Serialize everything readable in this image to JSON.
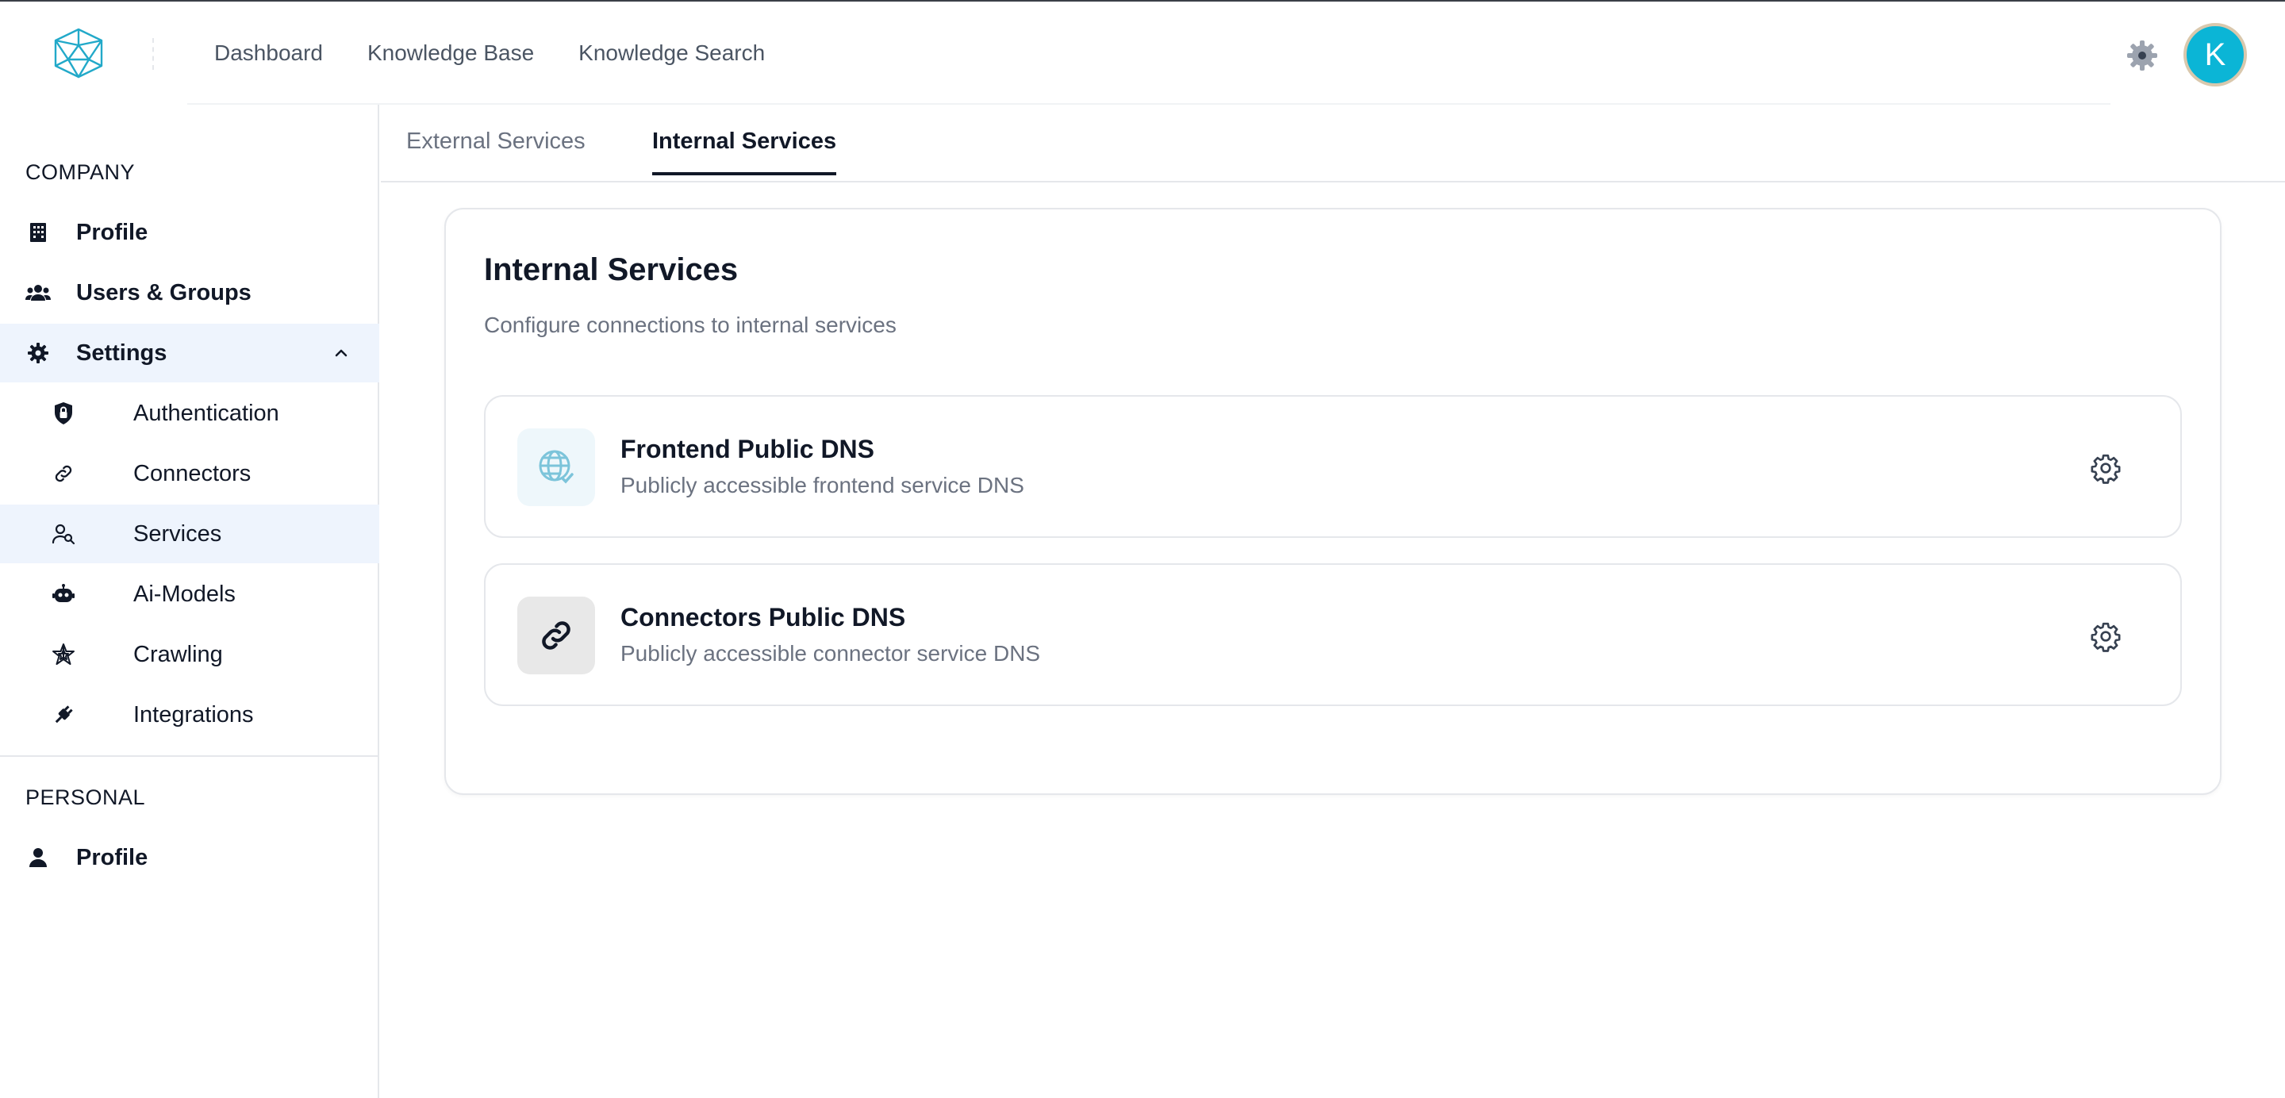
{
  "header": {
    "logo_icon": "polyhedron-logo-icon",
    "nav": [
      "Dashboard",
      "Knowledge Base",
      "Knowledge Search"
    ],
    "settings_icon": "gear-icon",
    "avatar_initial": "K",
    "accent_color": "#0bb5d6"
  },
  "sidebar": {
    "company_label": "COMPANY",
    "personal_label": "PERSONAL",
    "items": [
      {
        "label": "Profile",
        "icon": "building-icon"
      },
      {
        "label": "Users & Groups",
        "icon": "users-icon"
      },
      {
        "label": "Settings",
        "icon": "gear-icon",
        "expanded": true
      },
      {
        "label": "Authentication",
        "icon": "shield-lock-icon"
      },
      {
        "label": "Connectors",
        "icon": "link-icon"
      },
      {
        "label": "Services",
        "icon": "user-search-icon",
        "active": true
      },
      {
        "label": "Ai-Models",
        "icon": "robot-icon"
      },
      {
        "label": "Crawling",
        "icon": "spider-web-icon"
      },
      {
        "label": "Integrations",
        "icon": "plug-icon"
      }
    ],
    "personal_items": [
      {
        "label": "Profile",
        "icon": "person-icon"
      }
    ]
  },
  "tabs": [
    {
      "label": "External Services",
      "active": false
    },
    {
      "label": "Internal Services",
      "active": true
    }
  ],
  "main": {
    "title": "Internal Services",
    "subtitle": "Configure connections to internal services",
    "services": [
      {
        "name": "Frontend Public DNS",
        "description": "Publicly accessible frontend service DNS",
        "icon": "globe-check-icon",
        "icon_bg": "#eef7fb"
      },
      {
        "name": "Connectors Public DNS",
        "description": "Publicly accessible connector service DNS",
        "icon": "link-icon",
        "icon_bg": "#e8e8e8"
      }
    ]
  }
}
